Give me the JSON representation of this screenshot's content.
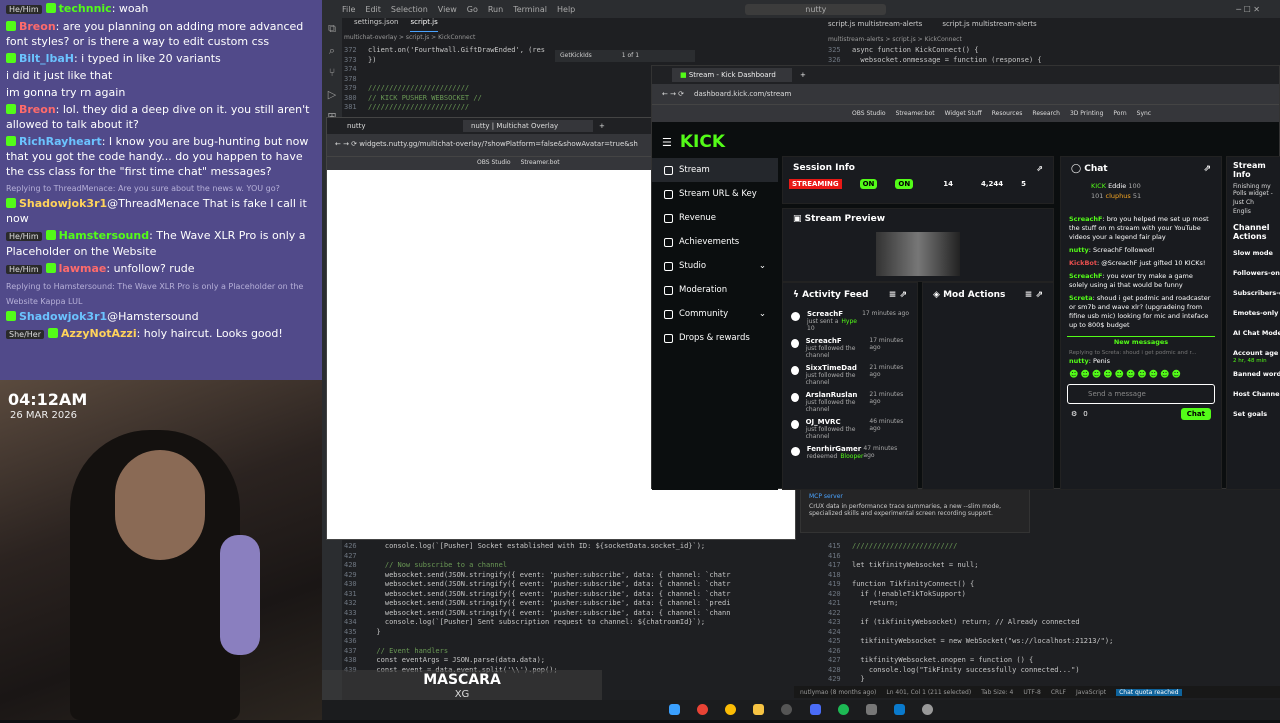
{
  "stream_chat": {
    "messages": [
      {
        "tag": "He/Him",
        "user": "technnic",
        "text": ": woah"
      },
      {
        "user": "Breon",
        "text": ": are you planning on adding more advanced font styles? or is there a way to edit custom css"
      },
      {
        "user": "Bilt_lbaH",
        "text": ": i typed in like 20 variants"
      },
      {
        "text": "i did it just like that"
      },
      {
        "text": "im gonna try rn again"
      },
      {
        "user": "Breon",
        "text": ": lol. they did a deep dive on it. you still aren't allowed to talk about it?"
      },
      {
        "user": "RichRayheart",
        "text": ": I know you are bug-hunting but now that you got the code handy... do you happen to have the css class for the \"first time chat\" messages?"
      },
      {
        "user": "Shadowjok3r1",
        "reply": "Replying to ThreadMenace: Are you sure about the news w. YOU go?",
        "text": "@ThreadMenace That is fake I call it now"
      },
      {
        "tag": "He/Him",
        "user": "Hamstersound",
        "text": ": The Wave XLR Pro is only a Placeholder on the Website"
      },
      {
        "tag": "He/Him",
        "user": "lawmae",
        "text": ": unfollow? rude"
      },
      {
        "user": "Shadowjok3r1",
        "reply": "Replying to Hamstersound: The Wave XLR Pro is only a Placeholder on the Website Kappa LUL",
        "text": "@Hamstersound"
      },
      {
        "tag": "She/Her",
        "user": "AzzyNotAzzi",
        "text": ": holy haircut. Looks good!"
      }
    ]
  },
  "webcam": {
    "time": "04:12AM",
    "date": "26 MAR 2026"
  },
  "now_playing": {
    "title": "MASCARA",
    "artist": "XG"
  },
  "editor": {
    "menu": [
      "File",
      "Edit",
      "Selection",
      "View",
      "Go",
      "Run",
      "Terminal",
      "Help"
    ],
    "search_text": "nutty",
    "tabs_left": [
      "settings.json",
      "script.js"
    ],
    "tab_right_a": "script.js multistream-alerts",
    "tab_right_b": "script.js multistream-alerts",
    "breadcrumb_left": "multichat-overlay > script.js > KickConnect",
    "breadcrumb_right": "multistream-alerts > script.js > KickConnect",
    "find_text": "GetKickIds",
    "find_count": "1 of 1",
    "top_code_left": [
      {
        "n": "372",
        "t": "client.on('Fourthwall.GiftDrawEnded', (res"
      },
      {
        "n": "373",
        "t": "})"
      },
      {
        "n": "374",
        "t": ""
      },
      {
        "n": "378",
        "t": ""
      },
      {
        "n": "379",
        "t": "////////////////////////"
      },
      {
        "n": "380",
        "t": "// KICK PUSHER WEBSOCKET //"
      },
      {
        "n": "381",
        "t": "////////////////////////"
      }
    ],
    "top_code_right": [
      {
        "n": "325",
        "t": "async function KickConnect() {"
      },
      {
        "n": "326",
        "t": "  websocket.onmessage = function (response) {"
      }
    ],
    "bottom_code_left": [
      {
        "n": "426",
        "t": "    console.log(`[Pusher] Socket established with ID: ${socketData.socket_id}`);"
      },
      {
        "n": "427",
        "t": ""
      },
      {
        "n": "428",
        "t": "    // Now subscribe to a channel"
      },
      {
        "n": "429",
        "t": "    websocket.send(JSON.stringify({ event: 'pusher:subscribe', data: { channel: `chatr"
      },
      {
        "n": "430",
        "t": "    websocket.send(JSON.stringify({ event: 'pusher:subscribe', data: { channel: `chatr"
      },
      {
        "n": "431",
        "t": "    websocket.send(JSON.stringify({ event: 'pusher:subscribe', data: { channel: `chatr"
      },
      {
        "n": "432",
        "t": "    websocket.send(JSON.stringify({ event: 'pusher:subscribe', data: { channel: `predi"
      },
      {
        "n": "433",
        "t": "    websocket.send(JSON.stringify({ event: 'pusher:subscribe', data: { channel: `chann"
      },
      {
        "n": "434",
        "t": "    console.log(`[Pusher] Sent subscription request to channel: ${chatroomId}`);"
      },
      {
        "n": "435",
        "t": "  }"
      },
      {
        "n": "436",
        "t": ""
      },
      {
        "n": "437",
        "t": "  // Event handlers"
      },
      {
        "n": "438",
        "t": "  const eventArgs = JSON.parse(data.data);"
      },
      {
        "n": "439",
        "t": "  const event = data.event.split('\\\\').pop();"
      }
    ],
    "bottom_code_right": [
      {
        "n": "415",
        "t": "/////////////////////////"
      },
      {
        "n": "416",
        "t": ""
      },
      {
        "n": "417",
        "t": "let tikfinityWebsocket = null;"
      },
      {
        "n": "418",
        "t": ""
      },
      {
        "n": "419",
        "t": "function TikfinityConnect() {"
      },
      {
        "n": "420",
        "t": "  if (!enableTikTokSupport)"
      },
      {
        "n": "421",
        "t": "    return;"
      },
      {
        "n": "422",
        "t": ""
      },
      {
        "n": "423",
        "t": "  if (tikfinityWebsocket) return; // Already connected"
      },
      {
        "n": "424",
        "t": ""
      },
      {
        "n": "425",
        "t": "  tikfinityWebsocket = new WebSocket(\"ws://localhost:21213/\");"
      },
      {
        "n": "426",
        "t": ""
      },
      {
        "n": "427",
        "t": "  tikfinityWebsocket.onopen = function () {"
      },
      {
        "n": "428",
        "t": "    console.log(\"TikFinity successfully connected...\")"
      },
      {
        "n": "429",
        "t": "  }"
      }
    ],
    "notice_title": "MCP server",
    "notice_text": "CrUX data in performance trace summaries, a new --slim mode, specialized skills and experimental screen recording support.",
    "status": {
      "git": "nutlymao (8 months ago)",
      "pos": "Ln 401, Col 1 (211 selected)",
      "tab": "Tab Size: 4",
      "enc": "UTF-8",
      "eol": "CRLF",
      "lang": "JavaScript",
      "quota": "Chat quota reached"
    }
  },
  "browser1": {
    "tabs": [
      "nutty",
      "nutty | Multichat Overlay"
    ],
    "url": "widgets.nutty.gg/multichat-overlay/?showPlatform=false&showAvatar=true&sh",
    "bookmarks": [
      "OBS Studio",
      "Streamer.bot"
    ]
  },
  "kick": {
    "tab": "Stream - Kick Dashboard",
    "url": "dashboard.kick.com/stream",
    "bookmarks": [
      "OBS Studio",
      "Streamer.bot",
      "Widget Stuff",
      "Resources",
      "Research",
      "3D Printing",
      "Porn",
      "Sync"
    ],
    "logo": "KICK",
    "nav": [
      {
        "label": "Stream",
        "icon": "broadcast-icon",
        "active": true
      },
      {
        "label": "Stream URL & Key",
        "icon": "key-icon"
      },
      {
        "label": "Revenue",
        "icon": "dollar-icon"
      },
      {
        "label": "Achievements",
        "icon": "trophy-icon"
      },
      {
        "label": "Studio",
        "icon": "studio-icon",
        "chevron": true
      },
      {
        "label": "Moderation",
        "icon": "shield-icon"
      },
      {
        "label": "Community",
        "icon": "people-icon",
        "chevron": true
      },
      {
        "label": "Drops & rewards",
        "icon": "gift-icon"
      }
    ],
    "session": {
      "title": "Session Info",
      "streaming": "STREAMING",
      "on1": "ON",
      "on2": "ON",
      "stat1": "14",
      "stat2": "4,244",
      "stat3": "5"
    },
    "preview_title": "Stream Preview",
    "activity": {
      "title": "Activity Feed",
      "items": [
        {
          "user": "ScreachF",
          "action": "just sent a",
          "extra": "Hype",
          "amount": "10",
          "time": "17 minutes ago"
        },
        {
          "user": "ScreachF",
          "action": "just followed the channel",
          "time": "17 minutes ago"
        },
        {
          "user": "SixxTimeDad",
          "action": "just followed the channel",
          "time": "21 minutes ago"
        },
        {
          "user": "ArslanRuslan",
          "action": "just followed the channel",
          "time": "21 minutes ago"
        },
        {
          "user": "OJ_MVRC",
          "action": "just followed the channel",
          "time": "46 minutes ago"
        },
        {
          "user": "FenrhirGamer",
          "action": "redeemed",
          "extra": "Blooper",
          "time": "47 minutes ago"
        }
      ]
    },
    "mod_actions": {
      "title": "Mod Actions"
    },
    "chat": {
      "title": "Chat",
      "top_user1": "Eddie",
      "top_user1_score": "100",
      "top_user2": "cluphus",
      "top_user2_score": "51",
      "kick_label": "KICK",
      "kick_count": "101",
      "lines": [
        {
          "user": "ScreachF",
          "text": ": bro you helped me set up most the stuff on m stream with your YouTube videos your a legend fair play"
        },
        {
          "user": "nutty",
          "text": ": ScreachF followed!"
        },
        {
          "user": "KickBot",
          "text": ": @ScreachF just gifted 10 KICKs!"
        },
        {
          "user": "ScreachF",
          "text": ": you ever try make a game solely using ai that would be funny"
        },
        {
          "user": "Screta",
          "text": ": shoud i get podmic and roadcaster or sm7b and wave xlr? (upgradeing from fifine usb mic) looking for mic and inteface up to 800$ budget"
        }
      ],
      "new_messages": "New messages",
      "reply_note": "Replying to Screta: shoud i get podmic and r...",
      "last_user": "nutty",
      "last_text": ": Penis",
      "placeholder": "Send a message",
      "count": "0",
      "send": "Chat"
    },
    "stream_info": {
      "title": "Stream Info",
      "snippet": "Finishing my Polls widget -",
      "just": "Just Ch",
      "lang": "Englis"
    },
    "channel_actions": {
      "title": "Channel Actions",
      "items": [
        "Slow mode",
        "Followers-only",
        "Subscribers-o",
        "Emotes-only",
        "AI Chat Mode",
        "Account age",
        "Banned words",
        "Host Channel",
        "Set goals"
      ],
      "account_age_value": "2 hr, 48 min"
    }
  }
}
